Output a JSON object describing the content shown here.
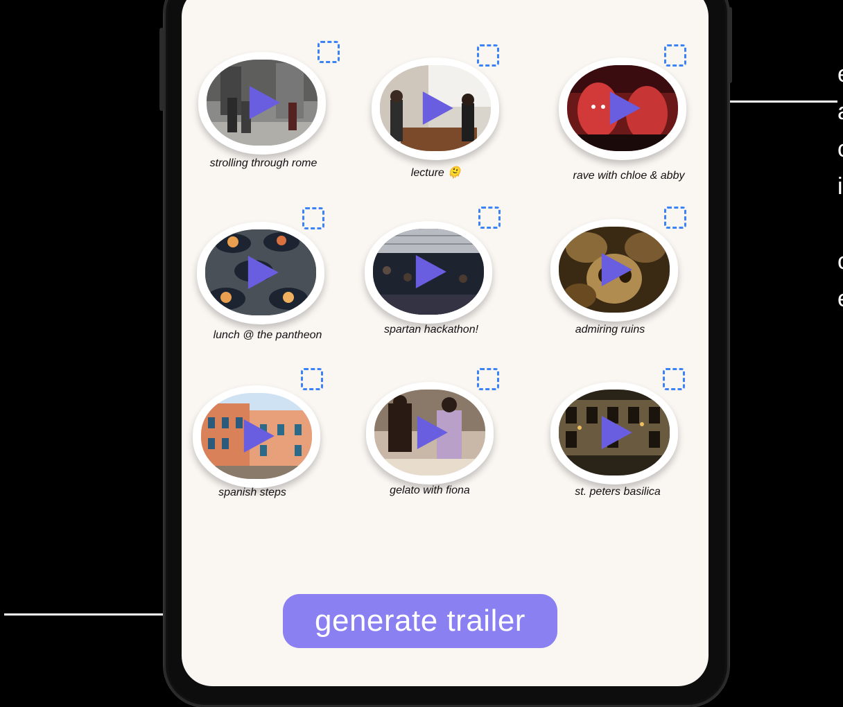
{
  "videos": [
    {
      "caption": "strolling through rome",
      "emoji": ""
    },
    {
      "caption": "lecture",
      "emoji": "🫠"
    },
    {
      "caption": "rave with chloe & abby",
      "emoji": ""
    },
    {
      "caption": "lunch @ the pantheon",
      "emoji": ""
    },
    {
      "caption": "spartan hackathon!",
      "emoji": ""
    },
    {
      "caption": "admiring ruins",
      "emoji": ""
    },
    {
      "caption": "spanish steps",
      "emoji": ""
    },
    {
      "caption": "gelato with fiona",
      "emoji": ""
    },
    {
      "caption": "st. peters basilica",
      "emoji": ""
    }
  ],
  "icons": {
    "play": "play-icon",
    "select": "checkbox-dashed-icon"
  },
  "generate_button": {
    "label": "generate trailer"
  },
  "colors": {
    "accent": "#8a80f2",
    "play": "#6a5ee0",
    "select_border": "#3b82f6",
    "screen_bg": "#faf6f2"
  },
  "side_text": {
    "lines": [
      "e",
      "a",
      "c",
      "i",
      "",
      "c",
      "e"
    ]
  }
}
